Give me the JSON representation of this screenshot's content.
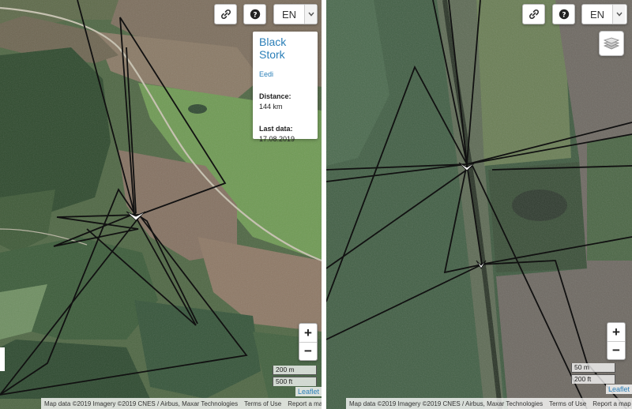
{
  "left_map": {
    "lang": {
      "value": "EN"
    },
    "popup": {
      "title": "Black Stork",
      "name": "Eedi",
      "distance_label": "Distance:",
      "distance_value": "144 km",
      "lastdata_label": "Last data:",
      "lastdata_value": "17.08.2019"
    },
    "zoom": {
      "in": "+",
      "out": "−"
    },
    "scale": {
      "metric": "200 m",
      "imperial": "500 ft"
    },
    "leaflet": "Leaflet",
    "attribution": {
      "imagery": "Map data ©2019 Imagery ©2019 CNES / Airbus, Maxar Technologies",
      "terms": "Terms of Use",
      "report": "Report a map error"
    }
  },
  "right_map": {
    "lang": {
      "value": "EN"
    },
    "zoom": {
      "in": "+",
      "out": "−"
    },
    "scale": {
      "metric": "50 m",
      "imperial": "200 ft"
    },
    "leaflet": "Leaflet",
    "attribution": {
      "imagery": "Map data ©2019 Imagery ©2019 CNES / Airbus, Maxar Technologies",
      "terms": "Terms of Use",
      "report": "Report a map error"
    }
  },
  "icons": {
    "link": "link-icon",
    "help": "help-icon",
    "chevron": "chevron-down-icon",
    "layers": "layers-icon",
    "bird_marker": "bird-marker-icon"
  },
  "colors": {
    "link_text": "#2b7fb8",
    "track_line": "#111111"
  }
}
